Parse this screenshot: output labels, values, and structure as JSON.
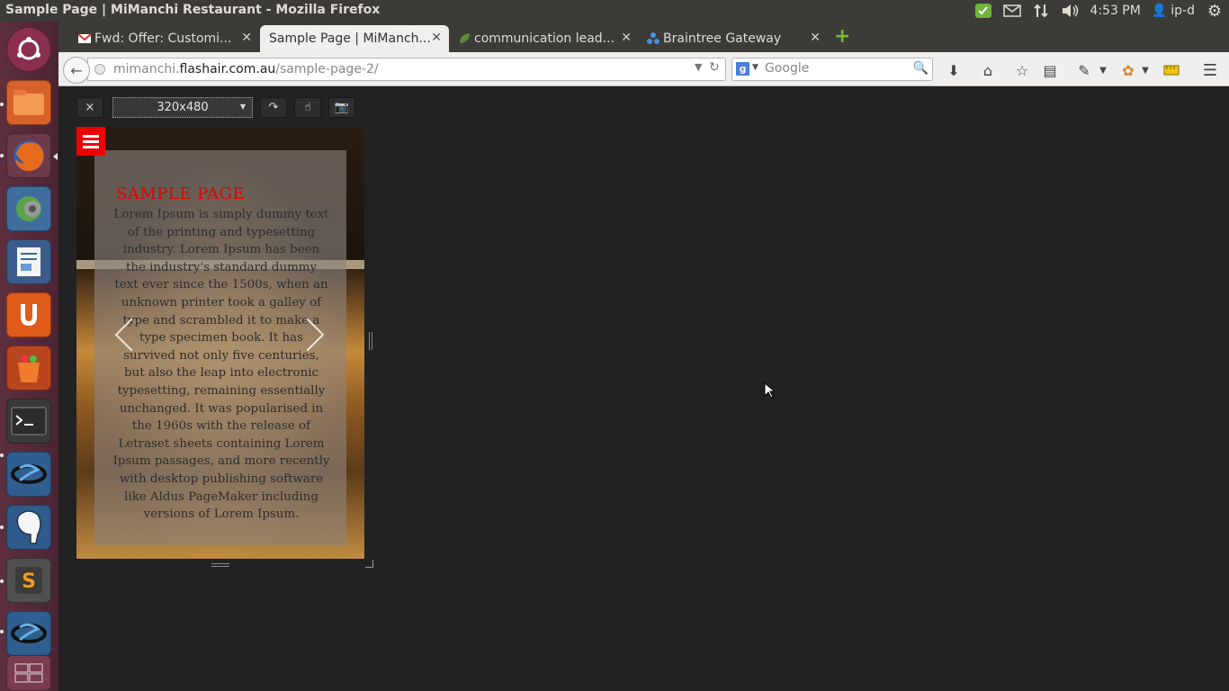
{
  "window": {
    "title": "Sample Page | MiManchi Restaurant - Mozilla Firefox"
  },
  "panel": {
    "time": "4:53 PM",
    "user": "ip-d"
  },
  "tabs": [
    {
      "label": "Fwd: Offer: Customi...",
      "icon": "gmail-icon",
      "active": false
    },
    {
      "label": "Sample Page | MiManch...",
      "icon": "none",
      "active": true
    },
    {
      "label": "communication lead...",
      "icon": "leaf-icon",
      "active": false
    },
    {
      "label": "Braintree Gateway",
      "icon": "braintree-icon",
      "active": false
    }
  ],
  "navbar": {
    "url_prefix": "mimanchi.",
    "url_host": "flashair.com.au",
    "url_path": "/sample-page-2/",
    "search_placeholder": "Google"
  },
  "responsive_toolbar": {
    "close_label": "×",
    "size_value": "320x480"
  },
  "page": {
    "heading": "SAMPLE PAGE",
    "body": "Lorem Ipsum is simply dummy text of the printing and typesetting industry. Lorem Ipsum has been the industry's standard dummy text ever since the 1500s, when an unknown printer took a galley of type and scrambled it to make a type specimen book. It has survived not only five centuries, but also the leap into electronic typesetting, remaining essentially unchanged. It was popularised in the 1960s with the release of Letraset sheets containing Lorem Ipsum passages, and more recently with desktop publishing software like Aldus PageMaker including versions of Lorem Ipsum."
  },
  "launcher": [
    "ubuntu-dash-icon",
    "files-icon",
    "firefox-icon",
    "system-settings-icon",
    "writer-icon",
    "ubuntu-one-icon",
    "software-center-icon",
    "terminal-icon",
    "app-s-icon",
    "postgres-icon",
    "sublime-icon",
    "app-s2-icon",
    "workspace-icon"
  ],
  "colors": {
    "accent_red": "#ee0000",
    "heading_red": "#e00000",
    "launcher_bg": "#5d2f3f",
    "panel_bg": "#3c3b37"
  }
}
